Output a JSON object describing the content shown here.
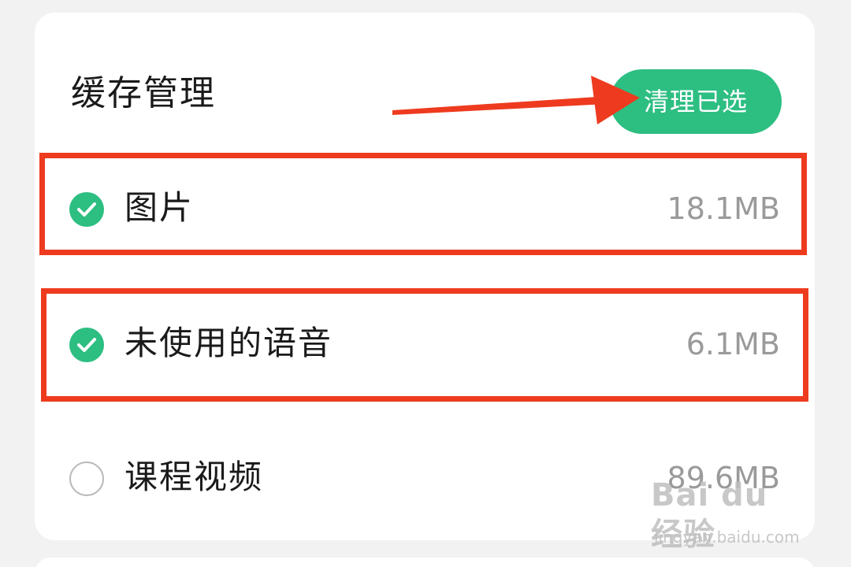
{
  "header": {
    "title": "缓存管理",
    "clean_button_label": "清理已选"
  },
  "items": [
    {
      "label": "图片",
      "size": "18.1MB",
      "checked": true,
      "highlighted": true
    },
    {
      "label": "未使用的语音",
      "size": "6.1MB",
      "checked": true,
      "highlighted": true
    },
    {
      "label": "课程视频",
      "size": "89.6MB",
      "checked": false,
      "highlighted": false
    }
  ],
  "colors": {
    "accent_green": "#2dbe82",
    "annotation_red": "#ee3b1f",
    "text_primary": "#1a1a1a",
    "text_secondary": "#9a9a9a"
  },
  "watermark": {
    "logo": "Bai du 经验",
    "url": "jingyan.baidu.com"
  }
}
